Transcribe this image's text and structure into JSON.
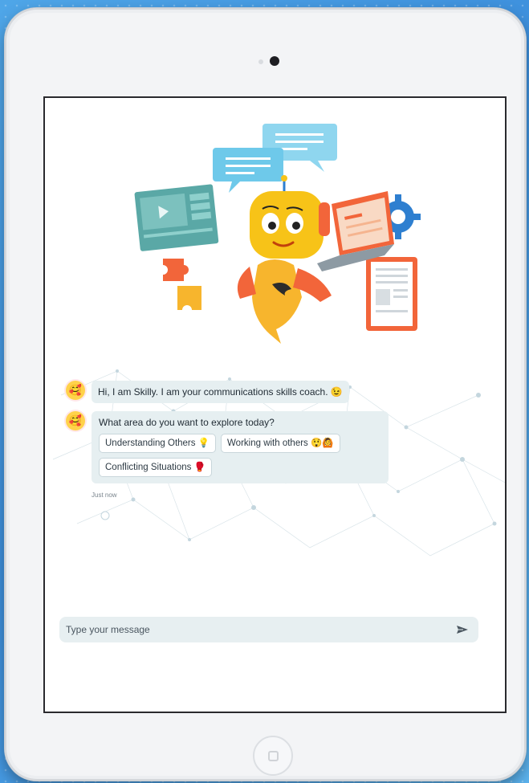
{
  "chat": {
    "greeting": "Hi, I am Skilly. I am your communications skills coach. 😉",
    "question": "What area do you want to explore today?",
    "options": [
      "Understanding Others 💡",
      "Working with others 😲🙆",
      "Conflicting Situations 🥊"
    ],
    "timestamp": "Just now",
    "avatar_emoji": "🥰"
  },
  "composer": {
    "placeholder": "Type your message"
  },
  "icons": {
    "send": "send-icon",
    "camera": "camera-icon",
    "home": "home-button-icon"
  },
  "colors": {
    "background": "#3d8fdc",
    "bubble": "#e6eff1",
    "robot": "#f7c318",
    "accent_orange": "#f2653a"
  }
}
